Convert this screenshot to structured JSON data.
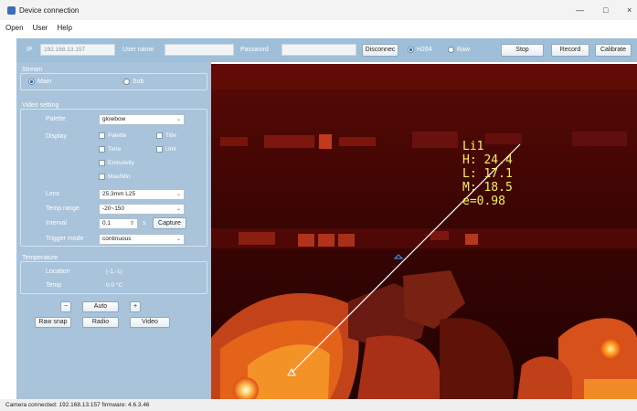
{
  "window": {
    "title": "Device connection",
    "controls": [
      "—",
      "□",
      "×"
    ]
  },
  "menu": {
    "items": [
      "Open",
      "User",
      "Help"
    ]
  },
  "toolbar": {
    "ip_label": "IP",
    "ip_value": "192.168.13.157",
    "username_placeholder": "User name",
    "password_label": "Password",
    "disconnect_label": "Disconnec",
    "h264_label": "H264",
    "raw_label": "Raw",
    "stop_label": "Stop",
    "record_label": "Record",
    "calibrate_label": "Calibrate",
    "selected_codec": "H264"
  },
  "stream": {
    "title": "Stream",
    "main_label": "Main",
    "sub_label": "Sub",
    "selected": "Main"
  },
  "video_setting": {
    "title": "Video setting",
    "palette_label": "Palette",
    "palette_value": "glowbow",
    "display_label": "Display",
    "display_options": {
      "palette": "Palette",
      "title": "Title",
      "time": "Time",
      "unit": "Unit",
      "emissivity": "Emissivity",
      "maxmin": "Max/Min"
    },
    "lens_label": "Lens",
    "lens_value": "25.3mm L25",
    "temp_range_label": "Temp range",
    "temp_range_value": "-20~150",
    "interval_label": "Interval",
    "interval_value": "0.1",
    "interval_unit": "s",
    "capture_label": "Capture",
    "trigger_mode_label": "Trigger mode",
    "trigger_mode_value": "continuous"
  },
  "temperature": {
    "title": "Temperature",
    "location_label": "Location",
    "location_value": "(-1,-1)",
    "temp_label": "Temp",
    "temp_value": "0.0 °C"
  },
  "controls": {
    "minus_label": "−",
    "auto_label": "Auto",
    "plus_label": "+",
    "raw_snap_label": "Raw snap",
    "radio_label": "Radio",
    "video_label": "Video"
  },
  "overlay": {
    "line_name": "Li1",
    "high": "H: 24.4",
    "low": "L: 17.1",
    "mean": "M: 18.5",
    "emissivity": "e=0.98"
  },
  "status": {
    "text": "Camera connected:  192.168.13.157  firmware:  4.6.3.46"
  },
  "colors": {
    "panel": "#a8c3da",
    "toolbar": "#9fbfd9",
    "overlay_text": "#f2f25a"
  }
}
